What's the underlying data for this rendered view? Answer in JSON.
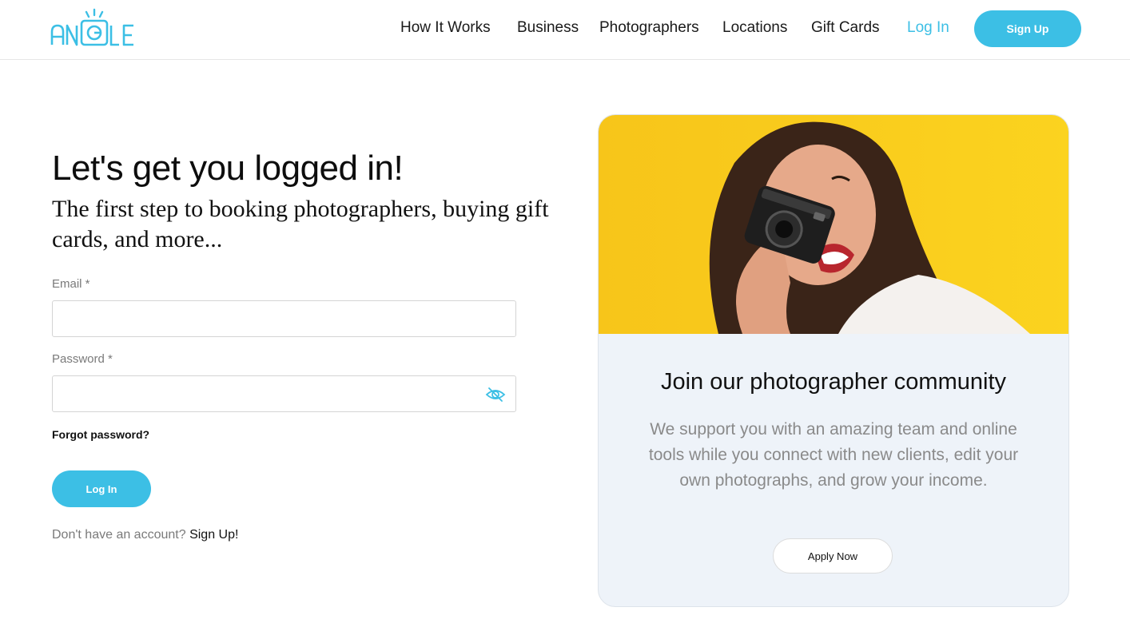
{
  "brand": {
    "logo_text": "ANGLE",
    "accent_color": "#3cbfe5"
  },
  "nav": {
    "items": [
      {
        "label": "How It Works"
      },
      {
        "label": "Business"
      },
      {
        "label": "Photographers"
      },
      {
        "label": "Locations"
      },
      {
        "label": "Gift Cards"
      }
    ],
    "login_label": "Log In",
    "signup_label": "Sign Up"
  },
  "login": {
    "heading": "Let's get you logged in!",
    "subheading": "The first step to booking photographers, buying gift cards, and more...",
    "email_label": "Email *",
    "email_value": "",
    "password_label": "Password *",
    "password_value": "",
    "password_toggle_icon": "eye-slash-icon",
    "forgot_label": "Forgot password?",
    "submit_label": "Log In",
    "no_account_text": "Don't have an account?",
    "signup_link": "Sign Up!"
  },
  "card": {
    "photo_description_icon": "woman-with-camera-photo",
    "title": "Join our photographer community",
    "text": "We support you with an amazing team and online tools while you connect with new clients, edit your own photographs, and grow your income.",
    "apply_label": "Apply Now"
  }
}
